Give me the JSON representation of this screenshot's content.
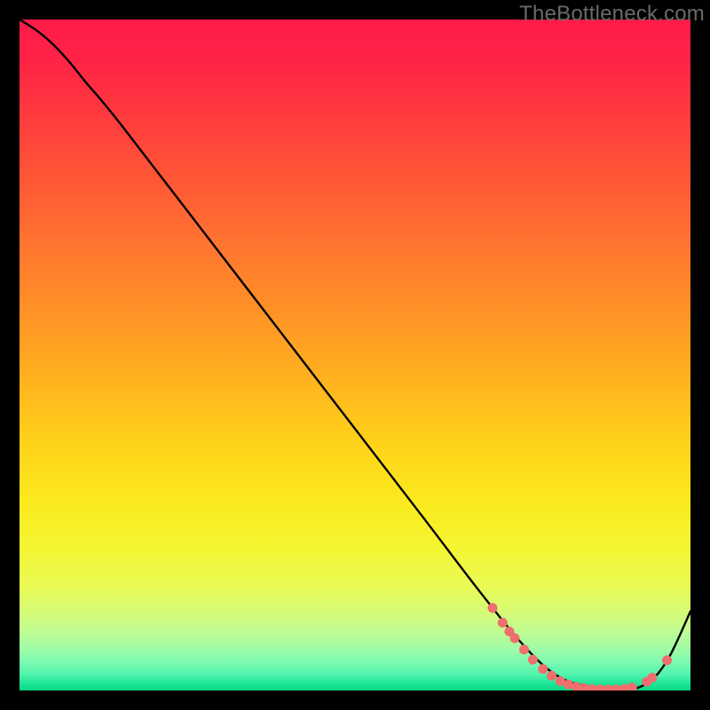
{
  "watermark": "TheBottleneck.com",
  "chart_data": {
    "type": "line",
    "title": "",
    "xlabel": "",
    "ylabel": "",
    "xlim": [
      0,
      100
    ],
    "ylim": [
      0,
      100
    ],
    "background_gradient": {
      "stops": [
        {
          "offset": 0.0,
          "color": "#ff1b49"
        },
        {
          "offset": 0.06,
          "color": "#ff2346"
        },
        {
          "offset": 0.14,
          "color": "#ff3a3f"
        },
        {
          "offset": 0.23,
          "color": "#ff5436"
        },
        {
          "offset": 0.33,
          "color": "#ff7330"
        },
        {
          "offset": 0.43,
          "color": "#ff9027"
        },
        {
          "offset": 0.53,
          "color": "#ffb01f"
        },
        {
          "offset": 0.63,
          "color": "#ffd21a"
        },
        {
          "offset": 0.72,
          "color": "#fbea1e"
        },
        {
          "offset": 0.79,
          "color": "#f4f633"
        },
        {
          "offset": 0.845,
          "color": "#e9fa55"
        },
        {
          "offset": 0.885,
          "color": "#d6fb78"
        },
        {
          "offset": 0.915,
          "color": "#bcfc95"
        },
        {
          "offset": 0.94,
          "color": "#9cfca8"
        },
        {
          "offset": 0.96,
          "color": "#77f9b0"
        },
        {
          "offset": 0.977,
          "color": "#4ef2ac"
        },
        {
          "offset": 0.99,
          "color": "#1de697"
        },
        {
          "offset": 1.0,
          "color": "#07d77e"
        }
      ]
    },
    "series": [
      {
        "name": "bottleneck-curve",
        "color": "#000000",
        "x": [
          0.0,
          2.5,
          5.0,
          7.5,
          10.0,
          12.0,
          15.0,
          20.0,
          30.0,
          40.0,
          50.0,
          60.0,
          68.0,
          74.0,
          78.0,
          81.0,
          84.0,
          87.0,
          90.0,
          92.0,
          94.5,
          97.0,
          100.0
        ],
        "y": [
          100.0,
          98.4,
          96.3,
          93.6,
          90.5,
          88.2,
          84.5,
          78.0,
          65.0,
          52.0,
          39.0,
          26.0,
          15.5,
          8.0,
          3.8,
          1.7,
          0.7,
          0.25,
          0.15,
          0.35,
          1.8,
          5.3,
          11.8
        ]
      }
    ],
    "markers": {
      "name": "highlight-points",
      "color": "#ef6e6e",
      "radius": 5.5,
      "points": [
        {
          "x": 70.5,
          "y": 12.3
        },
        {
          "x": 72.0,
          "y": 10.1
        },
        {
          "x": 73.0,
          "y": 8.8
        },
        {
          "x": 73.8,
          "y": 7.8
        },
        {
          "x": 75.2,
          "y": 6.1
        },
        {
          "x": 76.5,
          "y": 4.6
        },
        {
          "x": 78.0,
          "y": 3.2
        },
        {
          "x": 79.3,
          "y": 2.2
        },
        {
          "x": 80.6,
          "y": 1.4
        },
        {
          "x": 81.8,
          "y": 0.9
        },
        {
          "x": 83.0,
          "y": 0.55
        },
        {
          "x": 84.2,
          "y": 0.35
        },
        {
          "x": 85.4,
          "y": 0.22
        },
        {
          "x": 86.6,
          "y": 0.17
        },
        {
          "x": 87.8,
          "y": 0.15
        },
        {
          "x": 89.0,
          "y": 0.17
        },
        {
          "x": 90.2,
          "y": 0.25
        },
        {
          "x": 91.3,
          "y": 0.45
        },
        {
          "x": 93.5,
          "y": 1.3
        },
        {
          "x": 94.3,
          "y": 1.9
        },
        {
          "x": 96.5,
          "y": 4.5
        }
      ]
    }
  }
}
